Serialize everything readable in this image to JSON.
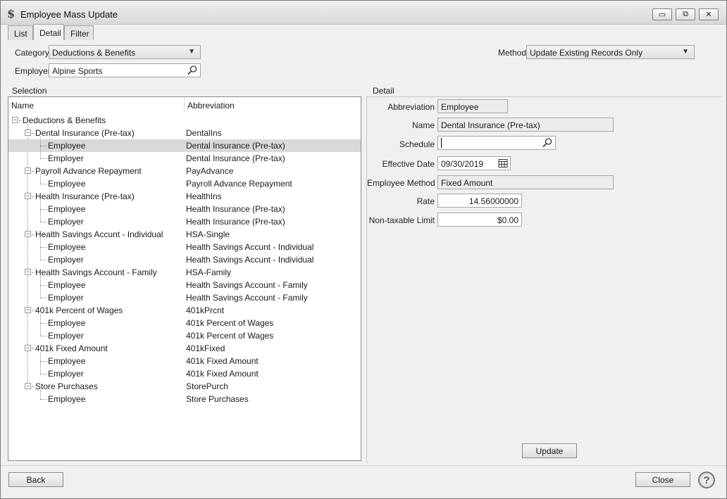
{
  "window": {
    "title": "Employee Mass Update",
    "app_icon": "$",
    "controls": {
      "minimize": "▭",
      "restore": "⧉",
      "close": "✕"
    }
  },
  "tabs": [
    {
      "label": "List",
      "active": false
    },
    {
      "label": "Detail",
      "active": true
    },
    {
      "label": "Filter",
      "active": false
    }
  ],
  "header": {
    "category_label": "Category",
    "category_value": "Deductions & Benefits",
    "employer_label": "Employer",
    "employer_value": "Alpine Sports",
    "method_label": "Method",
    "method_value": "Update Existing Records Only"
  },
  "selection": {
    "title": "Selection",
    "columns": {
      "name": "Name",
      "abbreviation": "Abbreviation"
    },
    "root": {
      "name": "Deductions & Benefits",
      "expander": "−"
    },
    "groups": [
      {
        "name": "Dental Insurance (Pre-tax)",
        "abbr": "DentalIns",
        "expander": "−",
        "children": [
          {
            "name": "Employee",
            "abbr": "Dental Insurance (Pre-tax)",
            "selected": true
          },
          {
            "name": "Employer",
            "abbr": "Dental Insurance (Pre-tax)",
            "selected": false
          }
        ]
      },
      {
        "name": "Payroll Advance Repayment",
        "abbr": "PayAdvance",
        "expander": "−",
        "children": [
          {
            "name": "Employee",
            "abbr": "Payroll Advance Repayment",
            "selected": false
          }
        ]
      },
      {
        "name": "Health Insurance (Pre-tax)",
        "abbr": "HealthIns",
        "expander": "−",
        "children": [
          {
            "name": "Employee",
            "abbr": "Health Insurance (Pre-tax)",
            "selected": false
          },
          {
            "name": "Employer",
            "abbr": "Health Insurance (Pre-tax)",
            "selected": false
          }
        ]
      },
      {
        "name": "Health Savings Accunt - Individual",
        "abbr": "HSA-Single",
        "expander": "−",
        "children": [
          {
            "name": "Employee",
            "abbr": "Health Savings Accunt - Individual",
            "selected": false
          },
          {
            "name": "Employer",
            "abbr": "Health Savings Accunt - Individual",
            "selected": false
          }
        ]
      },
      {
        "name": "Health Savings Account - Family",
        "abbr": "HSA-Family",
        "expander": "−",
        "children": [
          {
            "name": "Employee",
            "abbr": "Health Savings Account - Family",
            "selected": false
          },
          {
            "name": "Employer",
            "abbr": "Health Savings Account - Family",
            "selected": false
          }
        ]
      },
      {
        "name": "401k Percent of Wages",
        "abbr": "401kPrcnt",
        "expander": "−",
        "children": [
          {
            "name": "Employee",
            "abbr": "401k Percent of Wages",
            "selected": false
          },
          {
            "name": "Employer",
            "abbr": "401k Percent of Wages",
            "selected": false
          }
        ]
      },
      {
        "name": "401k Fixed Amount",
        "abbr": "401kFixed",
        "expander": "−",
        "children": [
          {
            "name": "Employee",
            "abbr": "401k Fixed Amount",
            "selected": false
          },
          {
            "name": "Employer",
            "abbr": "401k Fixed Amount",
            "selected": false
          }
        ]
      },
      {
        "name": "Store Purchases",
        "abbr": "StorePurch",
        "expander": "−",
        "children": [
          {
            "name": "Employee",
            "abbr": "Store Purchases",
            "selected": false
          }
        ]
      }
    ]
  },
  "detail": {
    "title": "Detail",
    "abbreviation_label": "Abbreviation",
    "abbreviation_value": "Employee",
    "name_label": "Name",
    "name_value": "Dental Insurance (Pre-tax)",
    "schedule_label": "Schedule",
    "schedule_value": "",
    "effective_date_label": "Effective Date",
    "effective_date_value": "09/30/2019",
    "employee_method_label": "Employee Method",
    "employee_method_value": "Fixed Amount",
    "rate_label": "Rate",
    "rate_value": "14.56000000",
    "nontaxable_label": "Non-taxable Limit",
    "nontaxable_value": "$0.00",
    "update_button": "Update"
  },
  "footer": {
    "back_button": "Back",
    "close_button": "Close",
    "help_icon": "?"
  }
}
